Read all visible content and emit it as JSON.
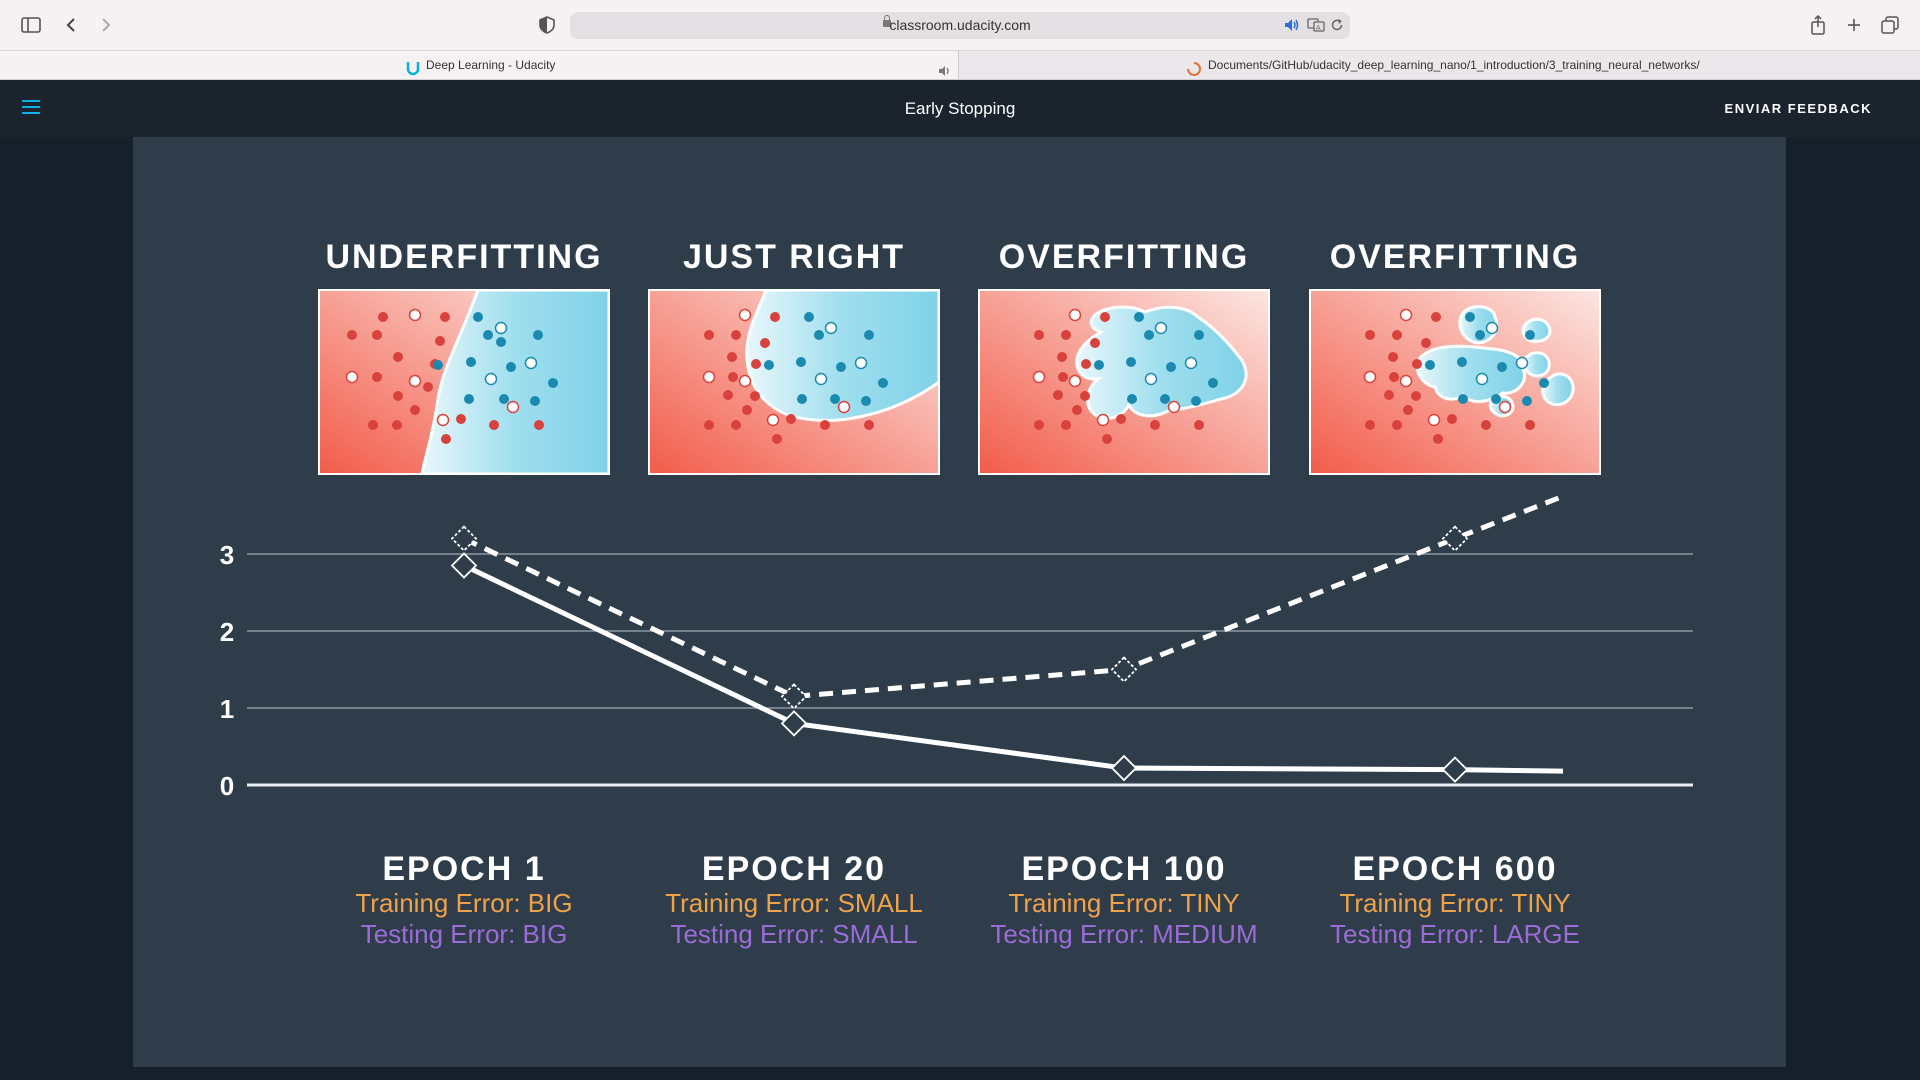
{
  "browser": {
    "url": "classroom.udacity.com",
    "tabs": [
      {
        "label": "Deep Learning - Udacity",
        "active": true
      },
      {
        "label": "Documents/GitHub/udacity_deep_learning_nano/1_introduction/3_training_neural_networks/",
        "active": false
      }
    ],
    "icons": [
      "sidebar-icon",
      "back-icon",
      "forward-icon",
      "shield-icon",
      "lock-icon",
      "speaker-icon",
      "translate-icon",
      "reload-icon",
      "share-icon",
      "new-tab-icon",
      "tabs-overview-icon"
    ]
  },
  "header": {
    "title": "Early Stopping",
    "feedback_label": "ENVIAR FEEDBACK",
    "accent": "#02b3e4"
  },
  "slide": {
    "panels": [
      {
        "title": "UNDERFITTING",
        "epoch": "EPOCH 1",
        "training": "Training Error: BIG",
        "testing": "Testing Error: BIG"
      },
      {
        "title": "JUST RIGHT",
        "epoch": "EPOCH 20",
        "training": "Training Error: SMALL",
        "testing": "Testing Error: SMALL"
      },
      {
        "title": "OVERFITTING",
        "epoch": "EPOCH 100",
        "training": "Training Error: TINY",
        "testing": "Testing Error: MEDIUM"
      },
      {
        "title": "OVERFITTING",
        "epoch": "EPOCH 600",
        "training": "Training Error: TINY",
        "testing": "Testing Error: LARGE"
      }
    ],
    "colors": {
      "training": "#f0a24a",
      "testing": "#9b6cd8",
      "red_region": "#f25c4a",
      "blue_region": "#8fd8ea",
      "red_point": "#d9413c",
      "blue_point": "#1b8ab0"
    }
  },
  "chart_data": {
    "type": "line",
    "categories": [
      "EPOCH 1",
      "EPOCH 20",
      "EPOCH 100",
      "EPOCH 600"
    ],
    "y_ticks": [
      "0",
      "1",
      "2",
      "3"
    ],
    "ylim": [
      0,
      3.8
    ],
    "grid": true,
    "series": [
      {
        "style": "solid",
        "values": [
          2.85,
          0.8,
          0.22,
          0.2
        ],
        "end_value": 0.18
      },
      {
        "style": "dashed",
        "values": [
          3.2,
          1.15,
          1.5,
          3.2
        ],
        "end_value": 3.75
      }
    ]
  }
}
